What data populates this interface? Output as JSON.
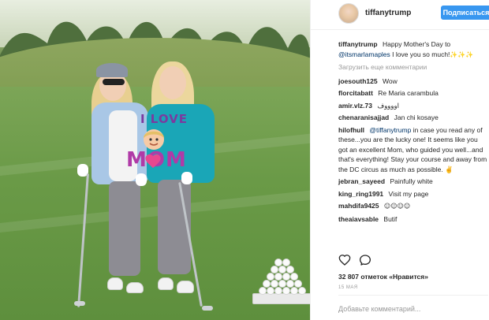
{
  "post": {
    "username": "tiffanytrump",
    "follow_label": "Подписаться",
    "caption_user": "tiffanytrump",
    "caption_text": "Happy Mother's Day to",
    "caption_mention": "@itsmarlamaples",
    "caption_rest": "I love you so much!",
    "caption_emoji": "✨✨✨",
    "load_more_label": "Загрузить еще комментарии"
  },
  "comments": [
    {
      "user": "joesouth125",
      "text": "Wow"
    },
    {
      "user": "florcitabatt",
      "text": "Re Maria carambula"
    },
    {
      "user": "amir.vlz.73",
      "text": "اووووف"
    },
    {
      "user": "chenaranisajjad",
      "text": "Jan chi kosaye"
    },
    {
      "user": "hilofhull",
      "mention": "@tiffanytrump",
      "text": "in case you read any of these...you are the lucky one! It seems like you got an excellent Mom, who guided you well...and that's everything! Stay your course and away from the DC circus as much as possible. ✌"
    },
    {
      "user": "jebran_sayeed",
      "text": "Painfully white"
    },
    {
      "user": "king_ring1991",
      "text": "Visit my page"
    },
    {
      "user": "mahdifa9425",
      "text": "☺☺☺☺"
    },
    {
      "user": "theaiavsable",
      "text": "Butif"
    }
  ],
  "footer": {
    "likes_text": "32 807 отметок «Нравится»",
    "date_text": "15 МАЯ",
    "add_comment_placeholder": "Добавьте комментарий..."
  },
  "photo": {
    "sweater_top_text": "I LOVE",
    "sweater_bottom_text": "MOM"
  },
  "icons": {
    "like": "heart-icon",
    "comment": "comment-icon"
  },
  "colors": {
    "follow_button": "#3897f0",
    "link": "#003569",
    "muted": "#999999"
  }
}
